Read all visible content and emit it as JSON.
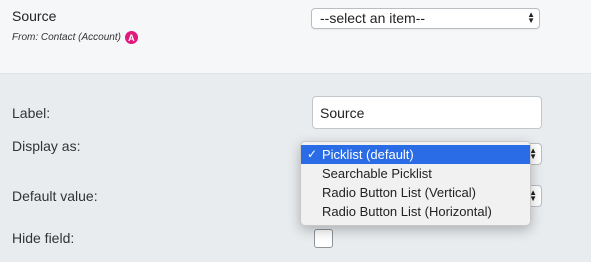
{
  "header": {
    "title": "Source",
    "from_text": "From: Contact (Account)",
    "badge": "A",
    "select_value": "--select an item--"
  },
  "form": {
    "label_label": "Label:",
    "label_value": "Source",
    "display_as_label": "Display as:",
    "default_value_label": "Default value:",
    "hide_field_label": "Hide field:",
    "hide_field_checked": false
  },
  "dropdown": {
    "options": [
      "Picklist (default)",
      "Searchable Picklist",
      "Radio Button List (Vertical)",
      "Radio Button List (Horizontal)"
    ],
    "selected_index": 0,
    "check_mark": "✓"
  },
  "colors": {
    "badge": "#e0197d",
    "selection": "#2a6ce6"
  }
}
